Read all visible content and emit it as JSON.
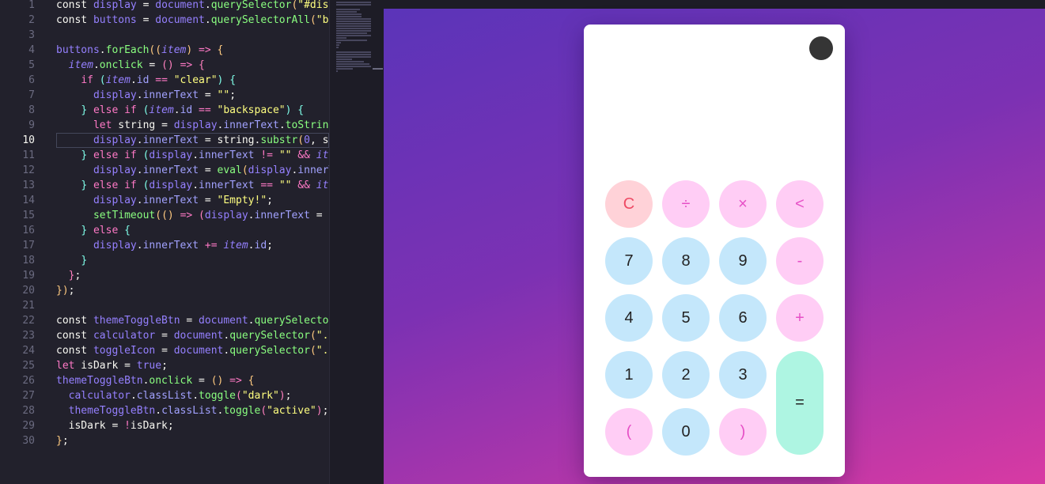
{
  "editor": {
    "lines": [
      {
        "n": "1",
        "t": [
          [
            "pl",
            "const "
          ],
          [
            "k2",
            "display"
          ],
          [
            "pl",
            " = "
          ],
          [
            "k2",
            "document"
          ],
          [
            "pl",
            "."
          ],
          [
            "fn",
            "querySelector"
          ],
          [
            "br",
            "("
          ],
          [
            "str",
            "\"#disp"
          ]
        ]
      },
      {
        "n": "2",
        "t": [
          [
            "pl",
            "const "
          ],
          [
            "k2",
            "buttons"
          ],
          [
            "pl",
            " = "
          ],
          [
            "k2",
            "document"
          ],
          [
            "pl",
            "."
          ],
          [
            "fn",
            "querySelectorAll"
          ],
          [
            "br",
            "("
          ],
          [
            "str",
            "\"bu"
          ]
        ]
      },
      {
        "n": "3",
        "t": []
      },
      {
        "n": "4",
        "t": [
          [
            "k2",
            "buttons"
          ],
          [
            "pl",
            "."
          ],
          [
            "fn",
            "forEach"
          ],
          [
            "br",
            "(("
          ],
          [
            "var",
            "item"
          ],
          [
            "br",
            ")"
          ],
          [
            "pl",
            " "
          ],
          [
            "kw",
            "=>"
          ],
          [
            "pl",
            " "
          ],
          [
            "br",
            "{"
          ]
        ]
      },
      {
        "n": "5",
        "t": [
          [
            "pl",
            "  "
          ],
          [
            "var",
            "item"
          ],
          [
            "pl",
            "."
          ],
          [
            "fn",
            "onclick"
          ],
          [
            "pl",
            " = "
          ],
          [
            "br2",
            "()"
          ],
          [
            "pl",
            " "
          ],
          [
            "kw",
            "=>"
          ],
          [
            "pl",
            " "
          ],
          [
            "br2",
            "{"
          ]
        ]
      },
      {
        "n": "6",
        "t": [
          [
            "pl",
            "    "
          ],
          [
            "kw",
            "if"
          ],
          [
            "pl",
            " "
          ],
          [
            "br3",
            "("
          ],
          [
            "var",
            "item"
          ],
          [
            "pl",
            "."
          ],
          [
            "prop",
            "id"
          ],
          [
            "pl",
            " "
          ],
          [
            "kw",
            "=="
          ],
          [
            "pl",
            " "
          ],
          [
            "str",
            "\"clear\""
          ],
          [
            "br3",
            ")"
          ],
          [
            "pl",
            " "
          ],
          [
            "br3",
            "{"
          ]
        ]
      },
      {
        "n": "7",
        "t": [
          [
            "pl",
            "      "
          ],
          [
            "k2",
            "display"
          ],
          [
            "pl",
            "."
          ],
          [
            "prop",
            "innerText"
          ],
          [
            "pl",
            " = "
          ],
          [
            "str",
            "\"\""
          ],
          [
            "pl",
            ";"
          ]
        ]
      },
      {
        "n": "8",
        "t": [
          [
            "pl",
            "    "
          ],
          [
            "br3",
            "}"
          ],
          [
            "pl",
            " "
          ],
          [
            "kw",
            "else if"
          ],
          [
            "pl",
            " "
          ],
          [
            "br3",
            "("
          ],
          [
            "var",
            "item"
          ],
          [
            "pl",
            "."
          ],
          [
            "prop",
            "id"
          ],
          [
            "pl",
            " "
          ],
          [
            "kw",
            "=="
          ],
          [
            "pl",
            " "
          ],
          [
            "str",
            "\"backspace\""
          ],
          [
            "br3",
            ")"
          ],
          [
            "pl",
            " "
          ],
          [
            "br3",
            "{"
          ]
        ]
      },
      {
        "n": "9",
        "t": [
          [
            "pl",
            "      "
          ],
          [
            "kw",
            "let"
          ],
          [
            "pl",
            " string = "
          ],
          [
            "k2",
            "display"
          ],
          [
            "pl",
            "."
          ],
          [
            "prop",
            "innerText"
          ],
          [
            "pl",
            "."
          ],
          [
            "fn",
            "toString"
          ]
        ]
      },
      {
        "n": "10",
        "active": true,
        "t": [
          [
            "pl",
            "      "
          ],
          [
            "k2",
            "display"
          ],
          [
            "pl",
            "."
          ],
          [
            "prop",
            "innerText"
          ],
          [
            "pl",
            " = string."
          ],
          [
            "fn",
            "substr"
          ],
          [
            "br",
            "("
          ],
          [
            "num",
            "0"
          ],
          [
            "pl",
            ", st"
          ]
        ]
      },
      {
        "n": "11",
        "t": [
          [
            "pl",
            "    "
          ],
          [
            "br3",
            "}"
          ],
          [
            "pl",
            " "
          ],
          [
            "kw",
            "else if"
          ],
          [
            "pl",
            " "
          ],
          [
            "br3",
            "("
          ],
          [
            "k2",
            "display"
          ],
          [
            "pl",
            "."
          ],
          [
            "prop",
            "innerText"
          ],
          [
            "pl",
            " "
          ],
          [
            "kw",
            "!="
          ],
          [
            "pl",
            " "
          ],
          [
            "str",
            "\"\""
          ],
          [
            "pl",
            " "
          ],
          [
            "kw",
            "&&"
          ],
          [
            "pl",
            " "
          ],
          [
            "var",
            "ite"
          ]
        ]
      },
      {
        "n": "12",
        "t": [
          [
            "pl",
            "      "
          ],
          [
            "k2",
            "display"
          ],
          [
            "pl",
            "."
          ],
          [
            "prop",
            "innerText"
          ],
          [
            "pl",
            " = "
          ],
          [
            "fn",
            "eval"
          ],
          [
            "br",
            "("
          ],
          [
            "k2",
            "display"
          ],
          [
            "pl",
            "."
          ],
          [
            "prop",
            "innerT"
          ]
        ]
      },
      {
        "n": "13",
        "t": [
          [
            "pl",
            "    "
          ],
          [
            "br3",
            "}"
          ],
          [
            "pl",
            " "
          ],
          [
            "kw",
            "else if"
          ],
          [
            "pl",
            " "
          ],
          [
            "br3",
            "("
          ],
          [
            "k2",
            "display"
          ],
          [
            "pl",
            "."
          ],
          [
            "prop",
            "innerText"
          ],
          [
            "pl",
            " "
          ],
          [
            "kw",
            "=="
          ],
          [
            "pl",
            " "
          ],
          [
            "str",
            "\"\""
          ],
          [
            "pl",
            " "
          ],
          [
            "kw",
            "&&"
          ],
          [
            "pl",
            " "
          ],
          [
            "var",
            "ite"
          ]
        ]
      },
      {
        "n": "14",
        "t": [
          [
            "pl",
            "      "
          ],
          [
            "k2",
            "display"
          ],
          [
            "pl",
            "."
          ],
          [
            "prop",
            "innerText"
          ],
          [
            "pl",
            " = "
          ],
          [
            "str",
            "\"Empty!\""
          ],
          [
            "pl",
            ";"
          ]
        ]
      },
      {
        "n": "15",
        "t": [
          [
            "pl",
            "      "
          ],
          [
            "fn",
            "setTimeout"
          ],
          [
            "br",
            "(("
          ],
          [
            "br",
            ")"
          ],
          [
            "pl",
            " "
          ],
          [
            "kw",
            "=>"
          ],
          [
            "pl",
            " "
          ],
          [
            "br2",
            "("
          ],
          [
            "k2",
            "display"
          ],
          [
            "pl",
            "."
          ],
          [
            "prop",
            "innerText"
          ],
          [
            "pl",
            " = "
          ],
          [
            "str",
            "\""
          ]
        ]
      },
      {
        "n": "16",
        "t": [
          [
            "pl",
            "    "
          ],
          [
            "br3",
            "}"
          ],
          [
            "pl",
            " "
          ],
          [
            "kw",
            "else"
          ],
          [
            "pl",
            " "
          ],
          [
            "br3",
            "{"
          ]
        ]
      },
      {
        "n": "17",
        "t": [
          [
            "pl",
            "      "
          ],
          [
            "k2",
            "display"
          ],
          [
            "pl",
            "."
          ],
          [
            "prop",
            "innerText"
          ],
          [
            "pl",
            " "
          ],
          [
            "kw",
            "+="
          ],
          [
            "pl",
            " "
          ],
          [
            "var",
            "item"
          ],
          [
            "pl",
            "."
          ],
          [
            "prop",
            "id"
          ],
          [
            "pl",
            ";"
          ]
        ]
      },
      {
        "n": "18",
        "t": [
          [
            "pl",
            "    "
          ],
          [
            "br3",
            "}"
          ]
        ]
      },
      {
        "n": "19",
        "t": [
          [
            "pl",
            "  "
          ],
          [
            "br2",
            "}"
          ],
          [
            "pl",
            ";"
          ]
        ]
      },
      {
        "n": "20",
        "t": [
          [
            "br",
            "})"
          ],
          [
            "pl",
            ";"
          ]
        ]
      },
      {
        "n": "21",
        "t": []
      },
      {
        "n": "22",
        "t": [
          [
            "pl",
            "const "
          ],
          [
            "k2",
            "themeToggleBtn"
          ],
          [
            "pl",
            " = "
          ],
          [
            "k2",
            "document"
          ],
          [
            "pl",
            "."
          ],
          [
            "fn",
            "querySelector"
          ]
        ]
      },
      {
        "n": "23",
        "t": [
          [
            "pl",
            "const "
          ],
          [
            "k2",
            "calculator"
          ],
          [
            "pl",
            " = "
          ],
          [
            "k2",
            "document"
          ],
          [
            "pl",
            "."
          ],
          [
            "fn",
            "querySelector"
          ],
          [
            "br",
            "("
          ],
          [
            "str",
            "\".c"
          ]
        ]
      },
      {
        "n": "24",
        "t": [
          [
            "pl",
            "const "
          ],
          [
            "k2",
            "toggleIcon"
          ],
          [
            "pl",
            " = "
          ],
          [
            "k2",
            "document"
          ],
          [
            "pl",
            "."
          ],
          [
            "fn",
            "querySelector"
          ],
          [
            "br",
            "("
          ],
          [
            "str",
            "\".t"
          ]
        ]
      },
      {
        "n": "25",
        "t": [
          [
            "kw",
            "let"
          ],
          [
            "pl",
            " isDark = "
          ],
          [
            "k2",
            "true"
          ],
          [
            "pl",
            ";"
          ]
        ]
      },
      {
        "n": "26",
        "t": [
          [
            "k2",
            "themeToggleBtn"
          ],
          [
            "pl",
            "."
          ],
          [
            "fn",
            "onclick"
          ],
          [
            "pl",
            " = "
          ],
          [
            "br",
            "()"
          ],
          [
            "pl",
            " "
          ],
          [
            "kw",
            "=>"
          ],
          [
            "pl",
            " "
          ],
          [
            "br",
            "{"
          ]
        ]
      },
      {
        "n": "27",
        "t": [
          [
            "pl",
            "  "
          ],
          [
            "k2",
            "calculator"
          ],
          [
            "pl",
            "."
          ],
          [
            "prop",
            "classList"
          ],
          [
            "pl",
            "."
          ],
          [
            "fn",
            "toggle"
          ],
          [
            "br2",
            "("
          ],
          [
            "str",
            "\"dark\""
          ],
          [
            "br2",
            ")"
          ],
          [
            "pl",
            ";"
          ]
        ]
      },
      {
        "n": "28",
        "t": [
          [
            "pl",
            "  "
          ],
          [
            "k2",
            "themeToggleBtn"
          ],
          [
            "pl",
            "."
          ],
          [
            "prop",
            "classList"
          ],
          [
            "pl",
            "."
          ],
          [
            "fn",
            "toggle"
          ],
          [
            "br2",
            "("
          ],
          [
            "str",
            "\"active\""
          ],
          [
            "br2",
            ")"
          ],
          [
            "pl",
            ";"
          ]
        ]
      },
      {
        "n": "29",
        "t": [
          [
            "pl",
            "  isDark = "
          ],
          [
            "kw",
            "!"
          ],
          [
            "pl",
            "isDark;"
          ]
        ]
      },
      {
        "n": "30",
        "t": [
          [
            "br",
            "}"
          ],
          [
            "pl",
            ";"
          ]
        ]
      }
    ]
  },
  "calculator": {
    "display_value": "",
    "theme_toggle_icon": "dark-circle-icon",
    "keys": [
      {
        "id": "clear",
        "label": "C",
        "kind": "clear",
        "col": 0,
        "row": 0
      },
      {
        "id": "/",
        "label": "÷",
        "kind": "op",
        "col": 1,
        "row": 0
      },
      {
        "id": "*",
        "label": "×",
        "kind": "op",
        "col": 2,
        "row": 0
      },
      {
        "id": "backspace",
        "label": "<",
        "kind": "op",
        "col": 3,
        "row": 0
      },
      {
        "id": "7",
        "label": "7",
        "kind": "num",
        "col": 0,
        "row": 1
      },
      {
        "id": "8",
        "label": "8",
        "kind": "num",
        "col": 1,
        "row": 1
      },
      {
        "id": "9",
        "label": "9",
        "kind": "num",
        "col": 2,
        "row": 1
      },
      {
        "id": "-",
        "label": "-",
        "kind": "op",
        "col": 3,
        "row": 1
      },
      {
        "id": "4",
        "label": "4",
        "kind": "num",
        "col": 0,
        "row": 2
      },
      {
        "id": "5",
        "label": "5",
        "kind": "num",
        "col": 1,
        "row": 2
      },
      {
        "id": "6",
        "label": "6",
        "kind": "num",
        "col": 2,
        "row": 2
      },
      {
        "id": "+",
        "label": "+",
        "kind": "op",
        "col": 3,
        "row": 2
      },
      {
        "id": "1",
        "label": "1",
        "kind": "num",
        "col": 0,
        "row": 3
      },
      {
        "id": "2",
        "label": "2",
        "kind": "num",
        "col": 1,
        "row": 3
      },
      {
        "id": "3",
        "label": "3",
        "kind": "num",
        "col": 2,
        "row": 3
      },
      {
        "id": "=",
        "label": "=",
        "kind": "equal",
        "col": 3,
        "row": 3
      },
      {
        "id": "(",
        "label": "(",
        "kind": "op",
        "col": 0,
        "row": 4
      },
      {
        "id": "0",
        "label": "0",
        "kind": "num",
        "col": 1,
        "row": 4
      },
      {
        "id": ")",
        "label": ")",
        "kind": "op",
        "col": 2,
        "row": 4
      }
    ],
    "colors": {
      "number_key": "#c4e7fb",
      "operator_key": "#ffcdf5",
      "clear_key": "#ffd2d8",
      "equal_key": "#aef5e2"
    }
  }
}
